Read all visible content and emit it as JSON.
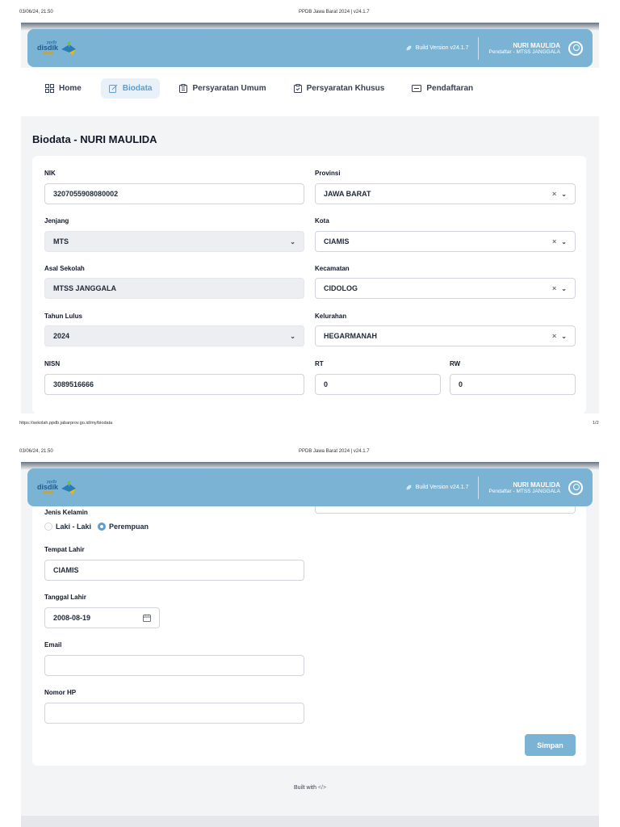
{
  "print": {
    "datetime": "03/06/24, 21.50",
    "doc_title": "PPDB Jawa Barat 2024 | v24.1.7",
    "url": "https://sekolah.ppdb.jabarprov.go.id/my/biodata",
    "page": "1/2"
  },
  "header": {
    "logo_top": "ppdb",
    "logo_main": "disdik",
    "logo_sub": "jabar",
    "build_label": "Build Version v24.1.7",
    "user_name": "NURI MAULIDA",
    "user_role": "Pendaftar - MTSS JANGGALA"
  },
  "nav": {
    "items": [
      {
        "label": "Home"
      },
      {
        "label": "Biodata"
      },
      {
        "label": "Persyaratan Umum"
      },
      {
        "label": "Persyaratan Khusus"
      },
      {
        "label": "Pendaftaran"
      }
    ]
  },
  "page_title": "Biodata - NURI MAULIDA",
  "form": {
    "nik": {
      "label": "NIK",
      "value": "3207055908080002"
    },
    "jenjang": {
      "label": "Jenjang",
      "value": "MTS"
    },
    "asal_sekolah": {
      "label": "Asal Sekolah",
      "value": "MTSS JANGGALA"
    },
    "tahun_lulus": {
      "label": "Tahun Lulus",
      "value": "2024"
    },
    "nisn": {
      "label": "NISN",
      "value": "3089516666"
    },
    "provinsi": {
      "label": "Provinsi",
      "value": "JAWA BARAT"
    },
    "kota": {
      "label": "Kota",
      "value": "CIAMIS"
    },
    "kecamatan": {
      "label": "Kecamatan",
      "value": "CIDOLOG"
    },
    "kelurahan": {
      "label": "Kelurahan",
      "value": "HEGARMANAH"
    },
    "rt": {
      "label": "RT",
      "value": "0"
    },
    "rw": {
      "label": "RW",
      "value": "0"
    },
    "jenis_kelamin": {
      "label": "Jenis Kelamin",
      "option_male": "Laki - Laki",
      "option_female": "Perempuan",
      "selected": "Perempuan"
    },
    "tempat_lahir": {
      "label": "Tempat Lahir",
      "value": "CIAMIS"
    },
    "tanggal_lahir": {
      "label": "Tanggal Lahir",
      "value": "2008-08-19"
    },
    "email": {
      "label": "Email",
      "value": ""
    },
    "nomor_hp": {
      "label": "Nomor HP",
      "value": ""
    }
  },
  "actions": {
    "save_label": "Simpan"
  },
  "footer": {
    "built_with": "Built with"
  },
  "colors": {
    "primary": "#7bb3d4",
    "accent": "#5b9ecf"
  }
}
